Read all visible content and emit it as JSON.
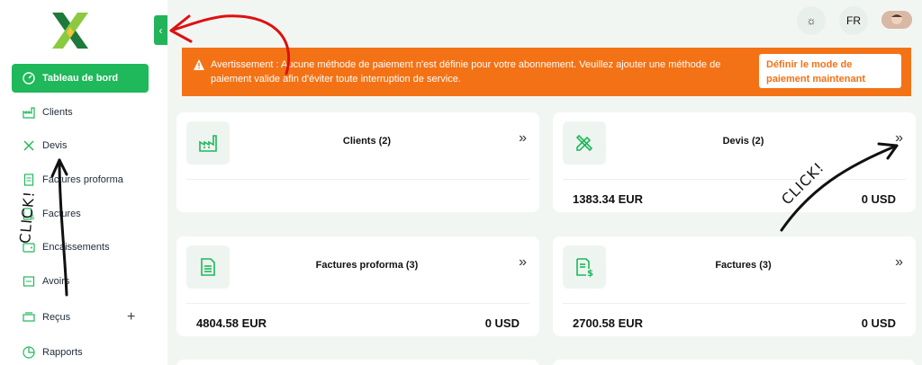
{
  "sidebar": {
    "items": [
      {
        "label": "Tableau de bord",
        "icon": "dashboard-icon"
      },
      {
        "label": "Clients",
        "icon": "factory-icon"
      },
      {
        "label": "Devis",
        "icon": "pencil-ruler-icon"
      },
      {
        "label": "Factures proforma",
        "icon": "document-icon"
      },
      {
        "label": "Factures",
        "icon": "invoice-icon"
      },
      {
        "label": "Encaissements",
        "icon": "wallet-icon"
      },
      {
        "label": "Avoirs",
        "icon": "credit-note-icon"
      },
      {
        "label": "Reçus",
        "icon": "receipt-icon"
      },
      {
        "label": "Rapports",
        "icon": "chart-icon"
      }
    ],
    "plus": "+"
  },
  "header": {
    "theme_icon": "☼",
    "language": "FR"
  },
  "banner": {
    "text": "Avertissement : Aucune méthode de paiement n'est définie pour votre abonnement. Veuillez ajouter une méthode de paiement valide afin d'éviter toute interruption de service.",
    "button": "Définir le mode de paiement maintenant"
  },
  "cards": [
    {
      "title": "Clients (2)",
      "left": "",
      "right": ""
    },
    {
      "title": "Devis (2)",
      "left": "1383.34 EUR",
      "right": "0 USD"
    },
    {
      "title": "Factures proforma (3)",
      "left": "4804.58 EUR",
      "right": "0 USD"
    },
    {
      "title": "Factures (3)",
      "left": "2700.58 EUR",
      "right": "0 USD"
    }
  ],
  "annotations": {
    "click_left": "CLICK!",
    "click_right": "CLICK!"
  },
  "colors": {
    "accent": "#1fb85a",
    "warning": "#f47216"
  }
}
